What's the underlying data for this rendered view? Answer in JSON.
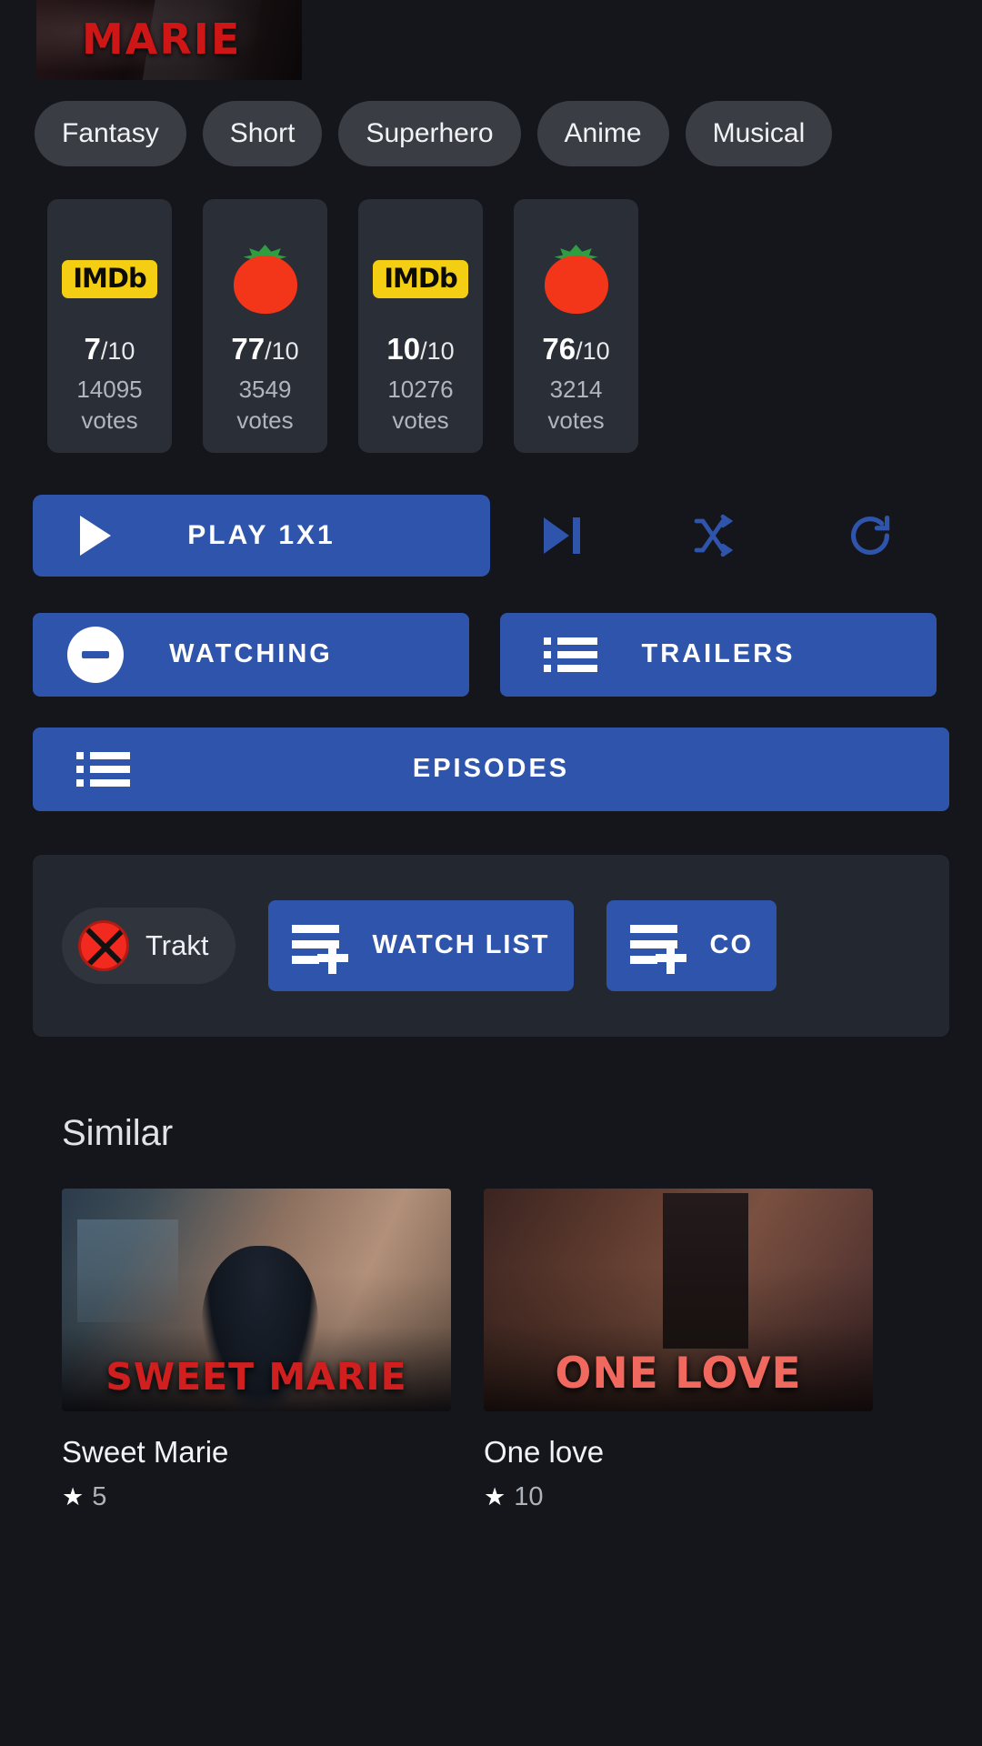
{
  "header": {
    "poster_title": "MARIE"
  },
  "genres": [
    {
      "label": "Fantasy"
    },
    {
      "label": "Short"
    },
    {
      "label": "Superhero"
    },
    {
      "label": "Anime"
    },
    {
      "label": "Musical"
    }
  ],
  "ratings": [
    {
      "source": "imdb-logo",
      "value": "7",
      "denominator": "/10",
      "votes": "14095",
      "votes_label": "votes"
    },
    {
      "source": "tomato-icon",
      "value": "77",
      "denominator": "/10",
      "votes": "3549",
      "votes_label": "votes"
    },
    {
      "source": "imdb-logo",
      "value": "10",
      "denominator": "/10",
      "votes": "10276",
      "votes_label": "votes"
    },
    {
      "source": "tomato-icon",
      "value": "76",
      "denominator": "/10",
      "votes": "3214",
      "votes_label": "votes"
    }
  ],
  "imdb_logo_text": "IMDb",
  "play_row": {
    "play_label": "PLAY 1X1",
    "next_icon": "skip-next-icon",
    "shuffle_icon": "shuffle-icon",
    "refresh_icon": "refresh-icon"
  },
  "actions": {
    "watching_label": "WATCHING",
    "trailers_label": "TRAILERS",
    "episodes_label": "EPISODES"
  },
  "trakt": {
    "name": "Trakt",
    "watch_list_label": "WATCH LIST",
    "collection_label": "CO"
  },
  "similar": {
    "title": "Similar",
    "items": [
      {
        "name": "Sweet Marie",
        "rating": "5",
        "overlay": "SWEET MARIE"
      },
      {
        "name": "One love",
        "rating": "10",
        "overlay": "ONE LOVE"
      }
    ],
    "star_glyph": "★"
  },
  "colors": {
    "accent_blue": "#2e54ab",
    "imdb_yellow": "#f3ce13",
    "tomato_red": "#f3361a",
    "trakt_red": "#f2291f",
    "background": "#15151c"
  }
}
